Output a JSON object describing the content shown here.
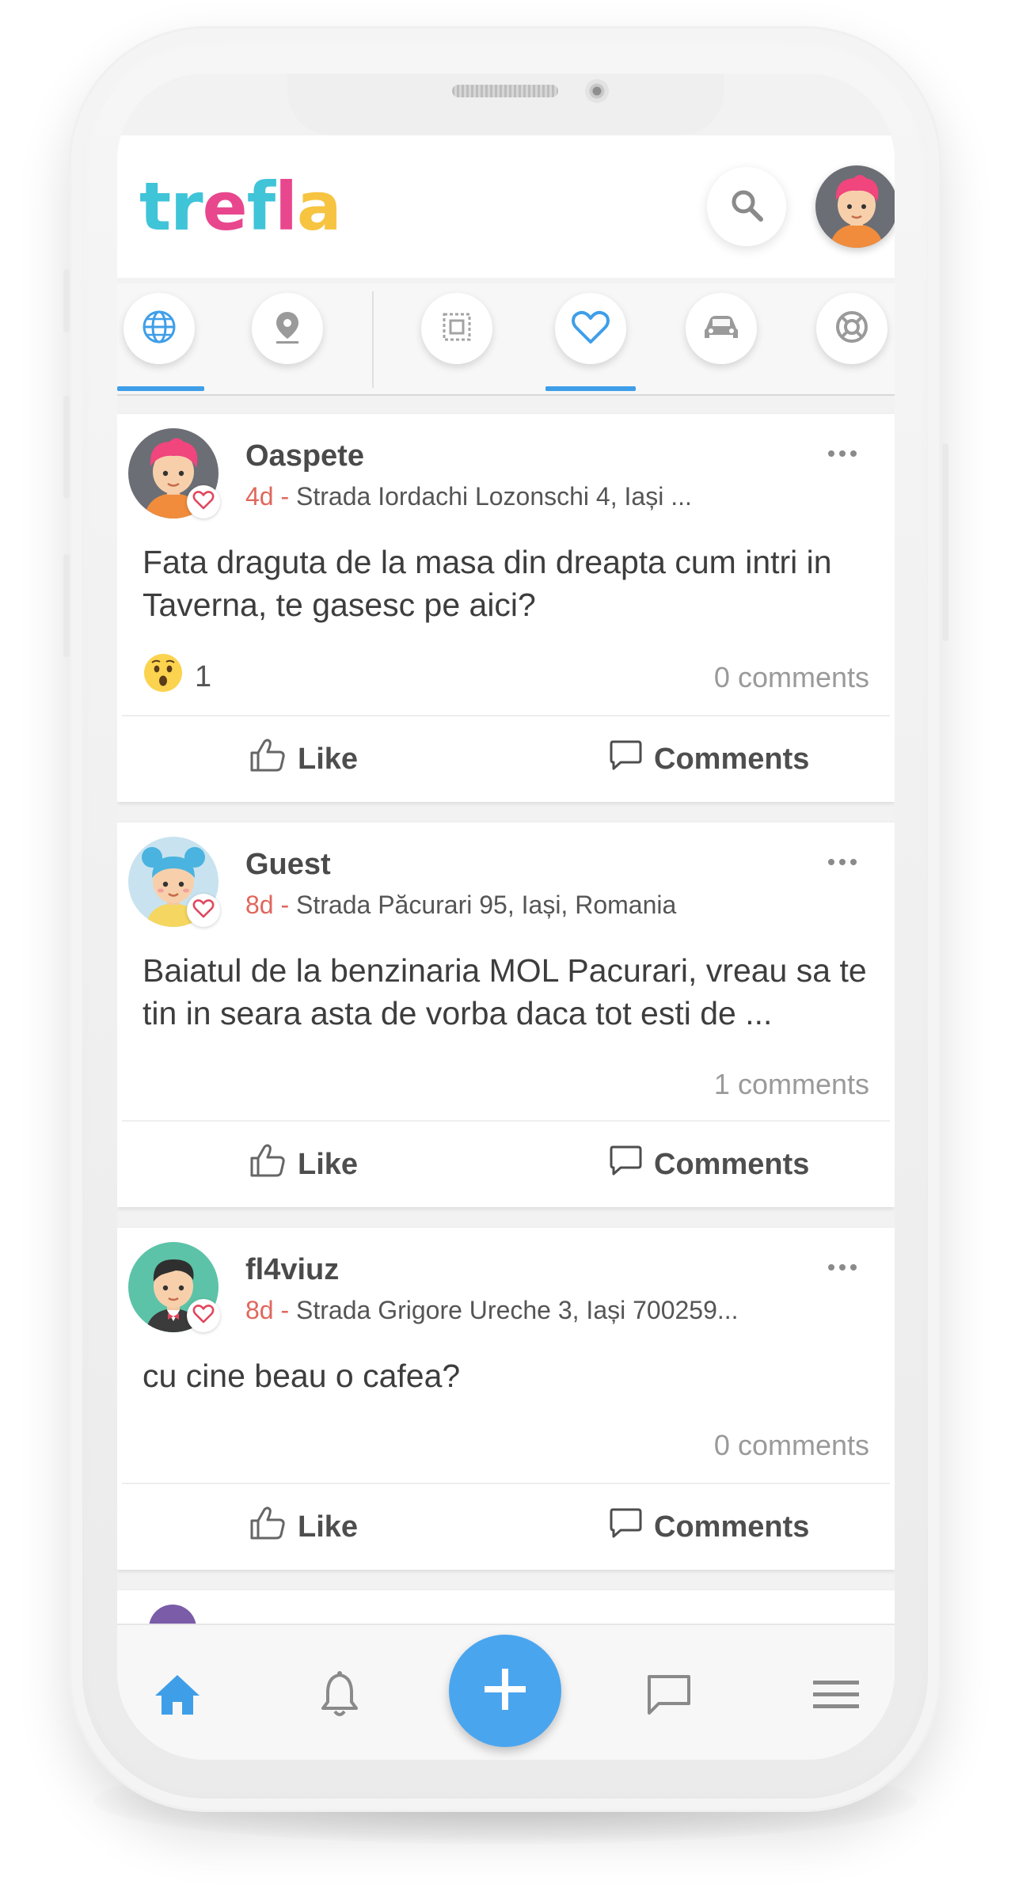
{
  "app": {
    "logo": "trefla",
    "logo_colors": [
      "#40c4d8",
      "#e8478e",
      "#f6c440"
    ]
  },
  "tabs": [
    {
      "icon": "globe-icon",
      "active": true
    },
    {
      "icon": "location-pin-icon",
      "active": false
    },
    {
      "icon": "frame-icon",
      "active": false
    },
    {
      "icon": "heart-icon",
      "active": true
    },
    {
      "icon": "car-icon",
      "active": false
    },
    {
      "icon": "lifebuoy-icon",
      "active": false
    }
  ],
  "posts": [
    {
      "author": "Oaspete",
      "time": "4d - ",
      "location": "Strada Iordachi Lozonschi 4, Iași ...",
      "text": "Fata draguta de la masa din dreapta cum intri in Taverna, te gasesc pe aici?",
      "reaction_emoji": "😮",
      "reaction_count": "1",
      "comments": "0 comments",
      "like_label": "Like",
      "comments_label": "Comments"
    },
    {
      "author": "Guest",
      "time": "8d - ",
      "location": "Strada Păcurari 95, Iași, Romania",
      "text": "Baiatul de la benzinaria MOL Pacurari, vreau sa te tin in seara asta de vorba daca tot esti de ...",
      "comments": "1 comments",
      "like_label": "Like",
      "comments_label": "Comments"
    },
    {
      "author": "fl4viuz",
      "time": "8d - ",
      "location": "Strada Grigore Ureche 3, Iași 700259...",
      "text": "cu cine beau o cafea?",
      "comments": "0 comments",
      "like_label": "Like",
      "comments_label": "Comments"
    }
  ],
  "colors": {
    "accent": "#3f9ee8",
    "time": "#e0675d",
    "fab": "#4aa5ef"
  }
}
